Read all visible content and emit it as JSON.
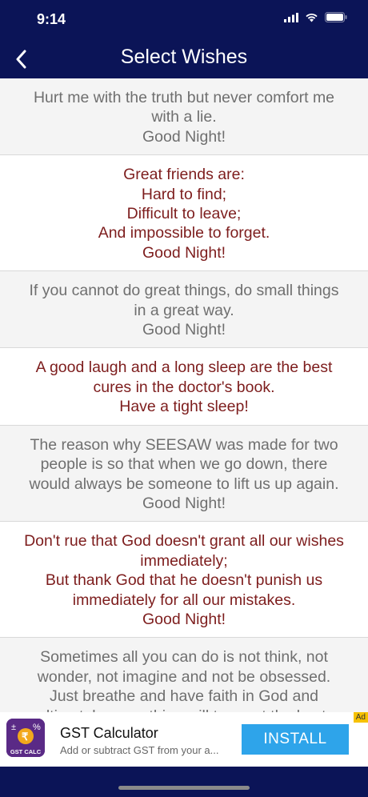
{
  "status_bar": {
    "time": "9:14"
  },
  "nav": {
    "title": "Select Wishes"
  },
  "wishes": [
    {
      "text": "Hurt me with the truth but never comfort me\nwith a lie.\nGood Night!",
      "style": "gray"
    },
    {
      "text": "Great friends are:\nHard to find;\nDifficult to leave;\nAnd impossible to forget.\nGood Night!",
      "style": "red"
    },
    {
      "text": "If you cannot do great things, do small things\nin a great way.\nGood Night!",
      "style": "gray"
    },
    {
      "text": "A good laugh and a long sleep are the best\ncures in the doctor's book.\nHave a tight sleep!",
      "style": "red"
    },
    {
      "text": "The reason why SEESAW was made for two\npeople is so that when we go down, there\nwould always be someone to lift us up again.\nGood Night!",
      "style": "gray"
    },
    {
      "text": "Don't rue that God doesn't grant all our wishes\nimmediately;\nBut thank God that he doesn't punish us\nimmediately for all our mistakes.\nGood Night!",
      "style": "red"
    },
    {
      "text": "Sometimes all you can do is not think, not\nwonder, not imagine and not be obsessed.\nJust breathe and have faith in God and\nultimately, everything will turn out the best.",
      "style": "gray"
    }
  ],
  "ad": {
    "title": "GST Calculator",
    "subtitle": "Add or subtract GST from your a...",
    "install_label": "INSTALL",
    "badge": "Ad",
    "icon_label": "GST CALC"
  },
  "colors": {
    "nav_bg": "#0b1457",
    "gray_text": "#6f6f6f",
    "red_text": "#7d1d1d",
    "install_bg": "#2ea4ea"
  }
}
